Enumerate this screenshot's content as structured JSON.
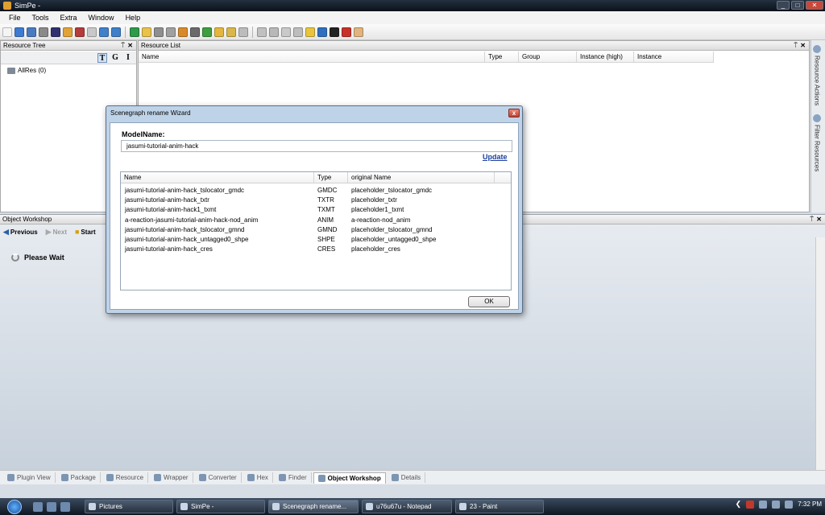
{
  "window": {
    "title": "SimPe -",
    "buttons": [
      "_",
      "□",
      "✕"
    ]
  },
  "menu": [
    "File",
    "Tools",
    "Extra",
    "Window",
    "Help"
  ],
  "toolbar": {
    "icon_colors": [
      "#f4f4f4",
      "#3c7bd1",
      "#4a7bc0",
      "#8a8a8a",
      "#303070",
      "#e1a239",
      "#b43c3c",
      "#c8c8c8",
      "#3f80c9",
      "#3f80c9",
      "#2e9a4a",
      "#e8c24a",
      "#8f8f8f",
      "#a0a0a0",
      "#d88a2b",
      "#6a6a6a",
      "#3f9e3f",
      "#e3b63d",
      "#d9b64a",
      "#bcbcbc",
      "#c0c0c0",
      "#b8b8b8",
      "#c9c9c9",
      "#bdbdbd",
      "#e9c53e",
      "#2f6fbd",
      "#222222",
      "#c8302a",
      "#e1b37e"
    ]
  },
  "resource_tree": {
    "header": "Resource Tree",
    "pin": "⍑",
    "close": "✕",
    "toggles": [
      "T",
      "G",
      "I"
    ],
    "node": "AllRes (0)"
  },
  "resource_list": {
    "header": "Resource List",
    "pin": "⍑",
    "close": "✕",
    "columns": [
      "Name",
      "Type",
      "Group",
      "Instance (high)",
      "Instance"
    ]
  },
  "side_tabs": [
    "Resource Actions",
    "Filter Resources"
  ],
  "object_workshop": {
    "header": "Object Workshop",
    "pin": "⍑",
    "close": "✕",
    "previous": "Previous",
    "next": "Next",
    "start": "Start",
    "status": "Please Wait"
  },
  "bottom_tabs": [
    "Plugin View",
    "Package",
    "Resource",
    "Wrapper",
    "Converter",
    "Hex",
    "Finder",
    "Object Workshop",
    "Details"
  ],
  "dialog": {
    "title": "Scenegraph rename Wizard",
    "close": "x",
    "model_label": "ModelName:",
    "model_value": "jasumi-tutorial-anim-hack",
    "update_link": "Update",
    "columns": [
      "Name",
      "Type",
      "original Name"
    ],
    "rows": [
      [
        "jasumi-tutorial-anim-hack_tslocator_gmdc",
        "GMDC",
        "placeholder_tslocator_gmdc"
      ],
      [
        "jasumi-tutorial-anim-hack_txtr",
        "TXTR",
        "placeholder_txtr"
      ],
      [
        "jasumi-tutorial-anim-hack1_txmt",
        "TXMT",
        "placeholder1_txmt"
      ],
      [
        "a-reaction-jasumi-tutorial-anim-hack-nod_anim",
        "ANIM",
        "a-reaction-nod_anim"
      ],
      [
        "jasumi-tutorial-anim-hack_tslocator_gmnd",
        "GMND",
        "placeholder_tslocator_gmnd"
      ],
      [
        "jasumi-tutorial-anim-hack_untagged0_shpe",
        "SHPE",
        "placeholder_untagged0_shpe"
      ],
      [
        "jasumi-tutorial-anim-hack_cres",
        "CRES",
        "placeholder_cres"
      ]
    ],
    "ok": "OK"
  },
  "taskbar": {
    "tasks": [
      "Pictures",
      "SimPe -",
      "Scenegraph rename...",
      "u76u67u - Notepad",
      "23 - Paint"
    ],
    "active_task": "Scenegraph rename...",
    "clock": "7:32 PM"
  }
}
